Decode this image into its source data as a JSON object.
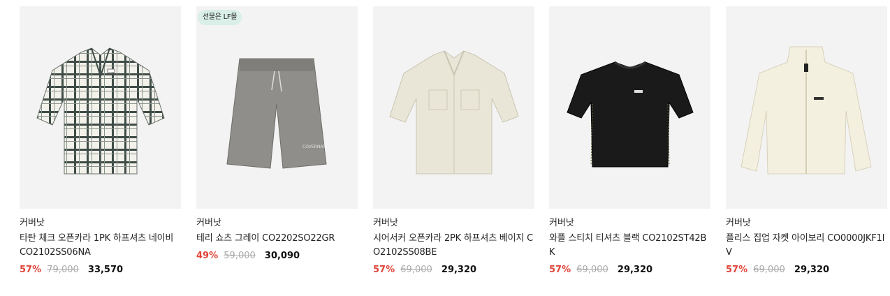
{
  "colors": {
    "discount": "#e0463b",
    "thumb_bg": "#f3f3f3",
    "badge_bg": "#d9efe8"
  },
  "products": [
    {
      "brand": "커버낫",
      "title": "타탄 체크 오픈카라 1PK 하프셔츠 네이비 CO2102SS06NA",
      "discount": "57%",
      "original_price": "79,000",
      "sale_price": "33,570",
      "badge": "",
      "image_icon": "plaid-shirt-image"
    },
    {
      "brand": "커버낫",
      "title": "테리 쇼츠 그레이 CO2202SO22GR",
      "discount": "49%",
      "original_price": "59,000",
      "sale_price": "30,090",
      "badge": "선물은 LF몰",
      "image_icon": "grey-shorts-image"
    },
    {
      "brand": "커버낫",
      "title": "시어서커 오픈카라 2PK 하프셔츠 베이지 CO2102SS08BE",
      "discount": "57%",
      "original_price": "69,000",
      "sale_price": "29,320",
      "badge": "",
      "image_icon": "beige-shirt-image"
    },
    {
      "brand": "커버낫",
      "title": "와플 스티치 티셔츠 블랙 CO2102ST42BK",
      "discount": "57%",
      "original_price": "69,000",
      "sale_price": "29,320",
      "badge": "",
      "image_icon": "black-tshirt-image"
    },
    {
      "brand": "커버낫",
      "title": "플리스 집업 자켓 아이보리 CO0000JKF1IV",
      "discount": "57%",
      "original_price": "69,000",
      "sale_price": "29,320",
      "badge": "",
      "image_icon": "ivory-fleece-jacket-image"
    }
  ]
}
